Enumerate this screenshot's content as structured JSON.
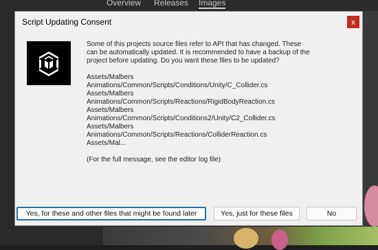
{
  "background": {
    "tabs": [
      "Overview",
      "Releases",
      "Images"
    ]
  },
  "dialog": {
    "title": "Script Updating Consent",
    "close_symbol": "x",
    "logo_icon": "unity-logo-icon",
    "intro": "Some of this projects source files refer to API that has changed. These can be automatically updated. It is recommended to have a backup of the project before updating. Do you want these files to be updated?",
    "files": [
      "Assets/Malbers",
      "Animations/Common/Scripts/Conditions/Unity/C_Collider.cs",
      "Assets/Malbers",
      "Animations/Common/Scripts/Reactions/RigidBodyReaction.cs",
      "Assets/Malbers",
      "Animations/Common/Scripts/Conditions2/Unity/C2_Collider.cs",
      "Assets/Malbers",
      "Animations/Common/Scripts/Reactions/ColliderReaction.cs",
      "Assets/Mal..."
    ],
    "footer_note": "(For the full message, see the editor log file)",
    "buttons": {
      "yes_all": "Yes, for these and other files that might be found later",
      "yes_these": "Yes, just for these files",
      "no": "No"
    }
  }
}
